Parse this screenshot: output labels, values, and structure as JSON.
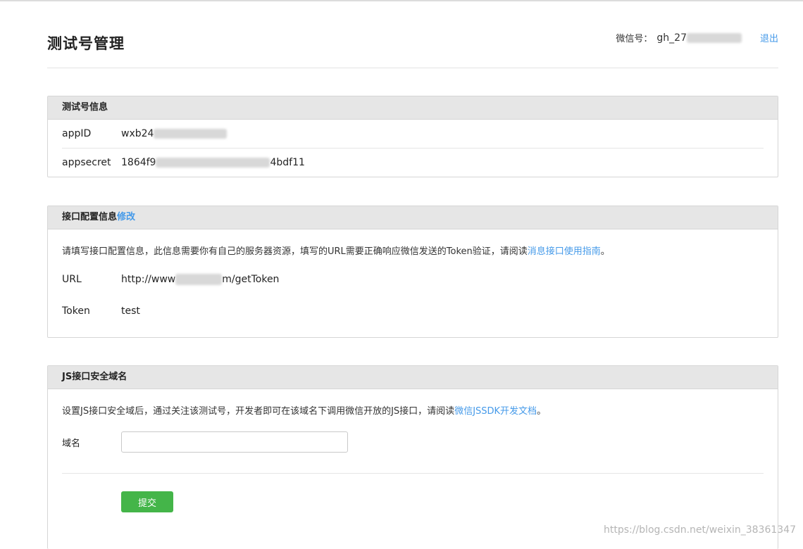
{
  "header": {
    "title": "测试号管理",
    "wechat_label": "微信号：",
    "wechat_id": "gh_27",
    "logout_label": "退出"
  },
  "info_panel": {
    "title": "测试号信息",
    "rows": [
      {
        "key": "appID",
        "value": "wxb24"
      },
      {
        "key": "appsecret",
        "value_prefix": "1864f9",
        "value_suffix": "4bdf11"
      }
    ]
  },
  "interface_panel": {
    "title": "接口配置信息",
    "edit_label": "修改",
    "description": "请填写接口配置信息，此信息需要你有自己的服务器资源，填写的URL需要正确响应微信发送的Token验证，请阅读",
    "description_link": "消息接口使用指南",
    "description_end": "。",
    "url_label": "URL",
    "url_prefix": "http://www",
    "url_suffix": "m/getToken",
    "token_label": "Token",
    "token_value": "test"
  },
  "js_panel": {
    "title": "JS接口安全域名",
    "description": "设置JS接口安全域后，通过关注该测试号，开发者即可在该域名下调用微信开放的JS接口，请阅读",
    "description_link": "微信JSSDK开发文档",
    "description_end": "。",
    "domain_label": "域名",
    "domain_value": "",
    "submit_label": "提交"
  },
  "watermark": "https://blog.csdn.net/weixin_38361347",
  "colors": {
    "link": "#459ae9",
    "submit": "#44b549",
    "panel_header": "#e6e6e6"
  }
}
